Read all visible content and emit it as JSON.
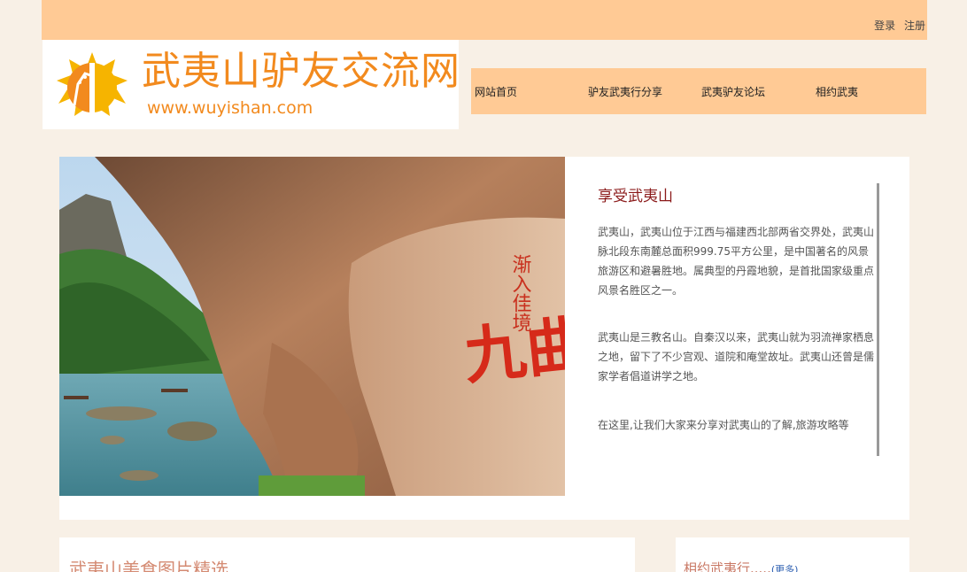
{
  "header": {
    "login_label": "登录",
    "register_label": "注册",
    "logo_title": "武夷山驴友交流网",
    "logo_url": "www.wuyishan.com"
  },
  "nav": {
    "items": [
      {
        "label": "网站首页"
      },
      {
        "label": "驴友武夷行分享"
      },
      {
        "label": "武夷驴友论坛"
      },
      {
        "label": "相约武夷"
      }
    ]
  },
  "hero": {
    "title": "享受武夷山",
    "paragraphs": [
      "武夷山，武夷山位于江西与福建西北部两省交界处，武夷山脉北段东南麓总面积999.75平方公里，是中国著名的风景旅游区和避暑胜地。属典型的丹霞地貌，是首批国家级重点风景名胜区之一。",
      "武夷山是三教名山。自秦汉以来，武夷山就为羽流禅家栖息之地，留下了不少宫观、道院和庵堂故址。武夷山还曾是儒家学者倡道讲学之地。",
      "在这里,让我们大家来分享对武夷山的了解,旅游攻略等"
    ],
    "photo_inscriptions": {
      "main": "九曲溪",
      "side": "渐入佳境"
    }
  },
  "sections": {
    "food_title": "武夷山美食图片精选",
    "meetup_title": "相约武夷行.....",
    "meetup_more": "(更多)"
  },
  "colors": {
    "header_bg": "#ffca95",
    "page_bg": "#f8f0e6",
    "logo_orange": "#f28a1e",
    "hero_title": "#8b1a1a"
  }
}
